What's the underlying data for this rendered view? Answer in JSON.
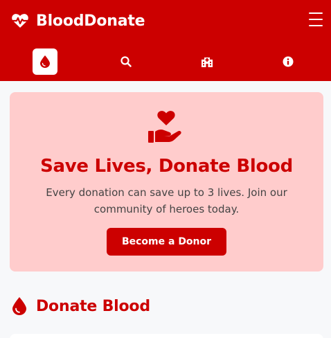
{
  "header": {
    "brand_name": "BloodDonate",
    "brand_icon": "heart-pulse-icon",
    "menu_icon": "hamburger-icon"
  },
  "nav": {
    "items": [
      {
        "icon": "blood-drop-icon",
        "active": true
      },
      {
        "icon": "search-icon",
        "active": false
      },
      {
        "icon": "hospital-icon",
        "active": false
      },
      {
        "icon": "info-icon",
        "active": false
      }
    ]
  },
  "hero": {
    "icon": "hand-holding-heart-icon",
    "title": "Save Lives, Donate Blood",
    "text": "Every donation can save up to 3 lives. Join our community of heroes today.",
    "button_label": "Become a Donor"
  },
  "section": {
    "icon": "blood-drop-icon",
    "title": "Donate Blood"
  },
  "colors": {
    "primary": "#cc0000",
    "hero_bg": "#ffcccc",
    "page_bg": "#f7f8fa"
  }
}
